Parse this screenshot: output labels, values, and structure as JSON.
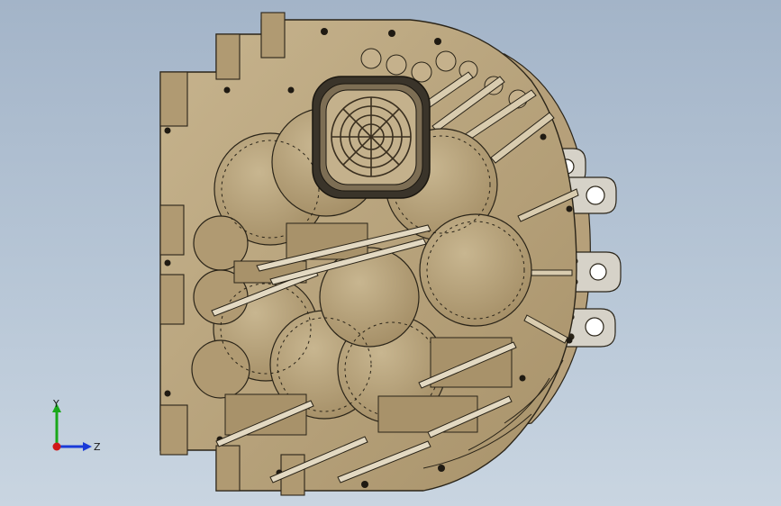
{
  "triad": {
    "y_label": "Y",
    "z_label": "Z",
    "x_color": "#d01818",
    "y_color": "#1aa81a",
    "z_color": "#1a3ad8"
  },
  "colors": {
    "background_top": "#a3b4c8",
    "background_bottom": "#c9d5e1",
    "housing": "#b9a47f",
    "housing_dark": "#8c7854",
    "edge": "#2a2418",
    "bracket": "#d6d2c8"
  }
}
